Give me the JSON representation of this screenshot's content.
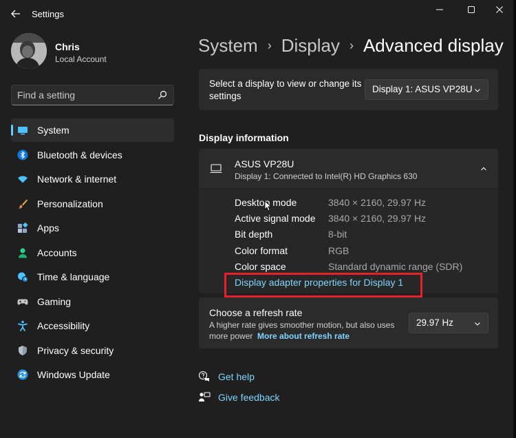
{
  "window": {
    "title": "Settings",
    "controls": [
      "minimize",
      "maximize",
      "close"
    ]
  },
  "user": {
    "name": "Chris",
    "account": "Local Account"
  },
  "search": {
    "placeholder": "Find a setting"
  },
  "sidebar": {
    "items": [
      {
        "label": "System",
        "icon": "monitor-icon",
        "active": true
      },
      {
        "label": "Bluetooth & devices",
        "icon": "bluetooth-icon"
      },
      {
        "label": "Network & internet",
        "icon": "wifi-icon"
      },
      {
        "label": "Personalization",
        "icon": "brush-icon"
      },
      {
        "label": "Apps",
        "icon": "apps-icon"
      },
      {
        "label": "Accounts",
        "icon": "person-icon"
      },
      {
        "label": "Time & language",
        "icon": "clock-globe-icon"
      },
      {
        "label": "Gaming",
        "icon": "gamepad-icon"
      },
      {
        "label": "Accessibility",
        "icon": "accessibility-icon"
      },
      {
        "label": "Privacy & security",
        "icon": "shield-icon"
      },
      {
        "label": "Windows Update",
        "icon": "update-icon"
      }
    ]
  },
  "breadcrumb": {
    "items": [
      "System",
      "Display",
      "Advanced display"
    ]
  },
  "select_display": {
    "text": "Select a display to view or change its settings",
    "selected": "Display 1: ASUS VP28U"
  },
  "display_info": {
    "section_title": "Display information",
    "monitor_name": "ASUS VP28U",
    "monitor_sub": "Display 1: Connected to Intel(R) HD Graphics 630",
    "properties": [
      {
        "label": "Desktop mode",
        "value": "3840 × 2160, 29.97 Hz"
      },
      {
        "label": "Active signal mode",
        "value": "3840 × 2160, 29.97 Hz"
      },
      {
        "label": "Bit depth",
        "value": "8-bit"
      },
      {
        "label": "Color format",
        "value": "RGB"
      },
      {
        "label": "Color space",
        "value": "Standard dynamic range (SDR)"
      }
    ],
    "adapter_link": "Display adapter properties for Display 1"
  },
  "refresh": {
    "title": "Choose a refresh rate",
    "desc": "A higher rate gives smoother motion, but also uses more power",
    "link": "More about refresh rate",
    "selected": "29.97 Hz"
  },
  "help": {
    "get_help": "Get help",
    "give_feedback": "Give feedback"
  },
  "colors": {
    "accent": "#60cdff",
    "link": "#7fd4ff",
    "highlight": "#e8202a"
  }
}
